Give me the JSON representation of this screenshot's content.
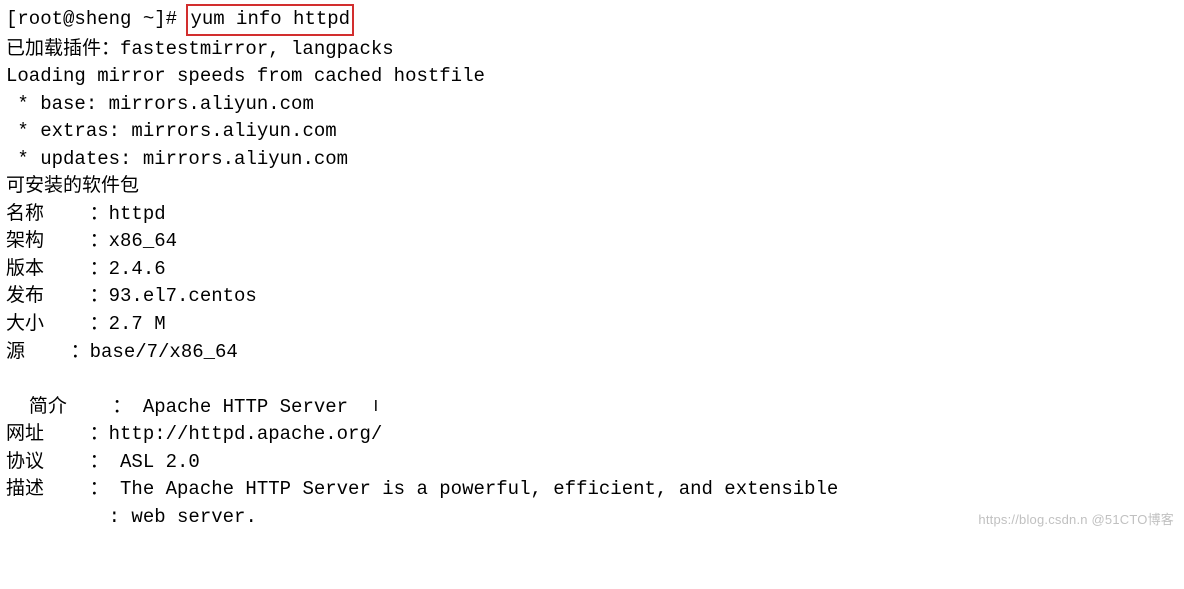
{
  "prompt": {
    "prefix": "[root@sheng ~]# ",
    "command": "yum info httpd"
  },
  "output": {
    "line_plugins": "已加载插件：fastestmirror, langpacks",
    "line_loading": "Loading mirror speeds from cached hostfile",
    "line_base": " * base: mirrors.aliyun.com",
    "line_extras": " * extras: mirrors.aliyun.com",
    "line_updates": " * updates: mirrors.aliyun.com",
    "line_section": "可安装的软件包"
  },
  "pkg": {
    "name": "名称    ：httpd",
    "arch": "架构    ：x86_64",
    "version": "版本    ：2.4.6",
    "release": "发布    ：93.el7.centos",
    "size": "大小    ：2.7 M",
    "repo": "源    ：base/7/x86_64",
    "summary_label": "简介    ： Apache HTTP Server  ",
    "url": "网址    ：http://httpd.apache.org/",
    "license": "协议    ： ASL 2.0",
    "desc1": "描述    ： The Apache HTTP Server is a powerful, efficient, and extensible",
    "desc2": "         : web server."
  },
  "watermark": "https://blog.csdn.n @51CTO博客"
}
